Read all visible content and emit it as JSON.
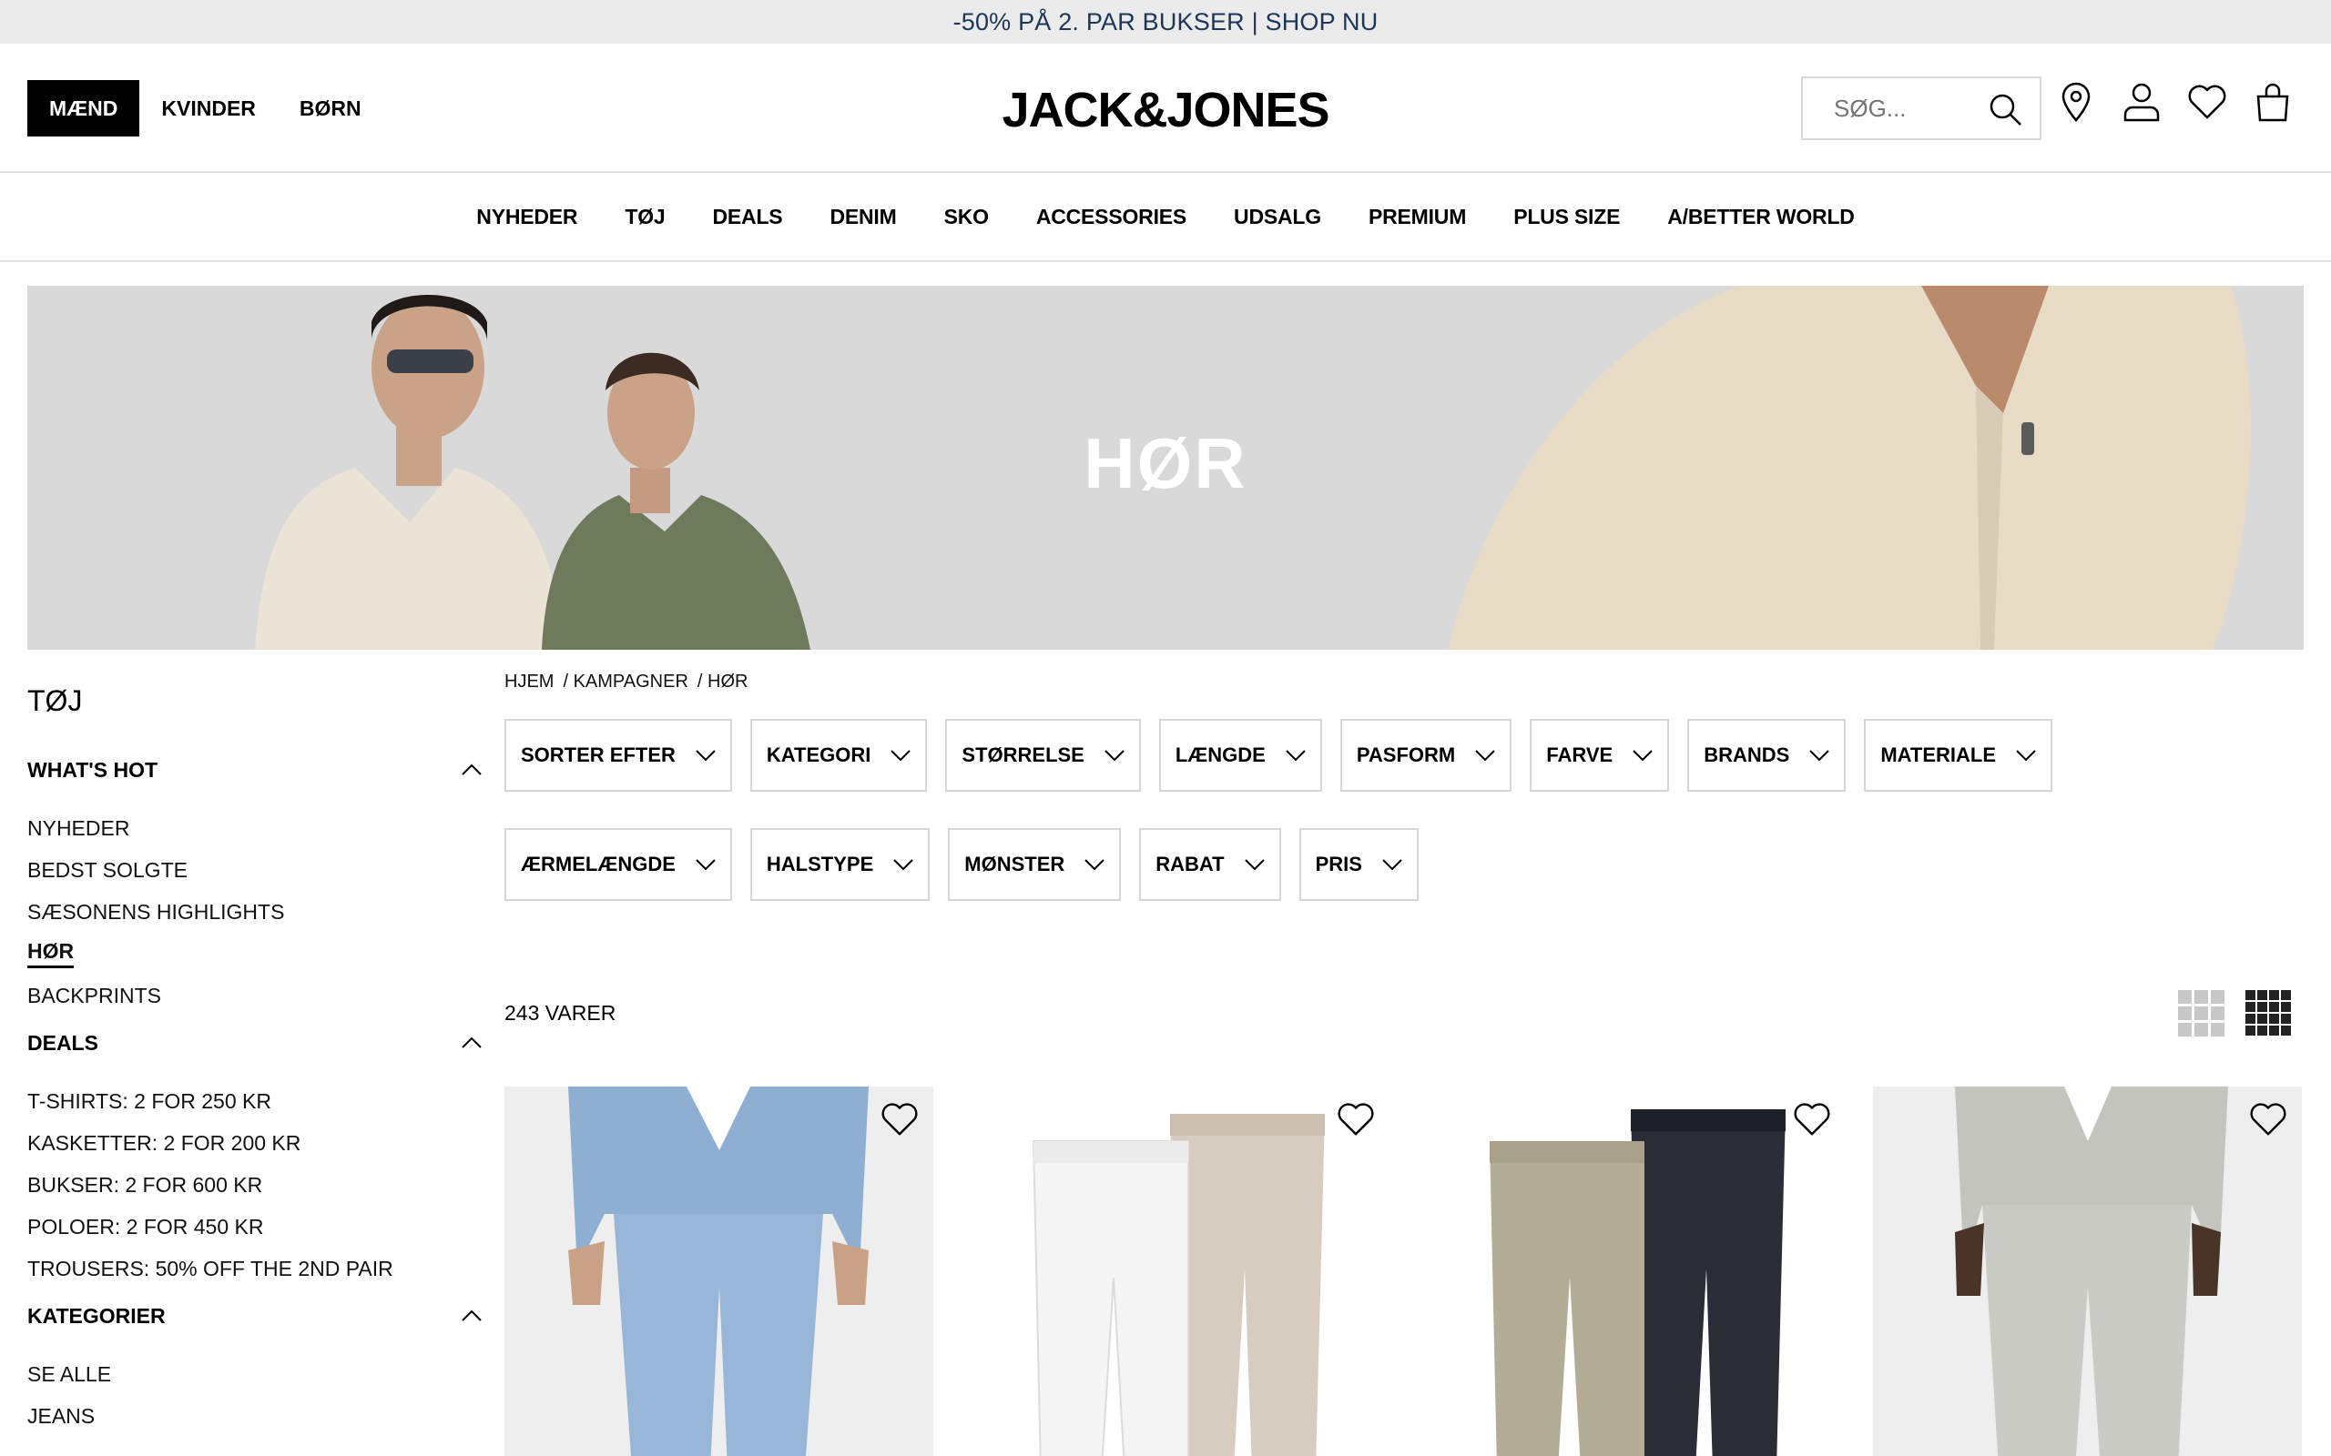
{
  "promo": {
    "text": "-50% PÅ 2. PAR BUKSER | SHOP NU"
  },
  "header": {
    "genders": [
      "MÆND",
      "KVINDER",
      "BØRN"
    ],
    "active_gender": "MÆND",
    "logo": "JACK&JONES",
    "search_placeholder": "SØG...",
    "icons": [
      "store-locator-icon",
      "account-icon",
      "wishlist-icon",
      "cart-icon"
    ]
  },
  "nav": [
    "NYHEDER",
    "TØJ",
    "DEALS",
    "DENIM",
    "SKO",
    "ACCESSORIES",
    "UDSALG",
    "PREMIUM",
    "PLUS SIZE",
    "A/BETTER WORLD"
  ],
  "hero": {
    "title": "HØR"
  },
  "sidebar": {
    "title": "TØJ",
    "sections": [
      {
        "heading": "WHAT'S HOT",
        "items": [
          "NYHEDER",
          "BEDST SOLGTE",
          "SÆSONENS HIGHLIGHTS",
          "HØR",
          "BACKPRINTS"
        ],
        "current": "HØR"
      },
      {
        "heading": "DEALS",
        "items": [
          "T-SHIRTS: 2 FOR 250 KR",
          "KASKETTER: 2 FOR 200 KR",
          "BUKSER: 2 FOR 600 KR",
          "POLOER: 2 FOR 450 KR",
          "TROUSERS: 50% OFF THE 2ND PAIR"
        ]
      },
      {
        "heading": "KATEGORIER",
        "items": [
          "SE ALLE",
          "JEANS"
        ]
      }
    ]
  },
  "breadcrumb": [
    "HJEM",
    "/ KAMPAGNER",
    "/ HØR"
  ],
  "filters": {
    "row1": [
      "SORTER EFTER",
      "KATEGORI",
      "STØRRELSE",
      "LÆNGDE",
      "PASFORM",
      "FARVE",
      "BRANDS",
      "MATERIALE"
    ],
    "row2": [
      "ÆRMELÆNGDE",
      "HALSTYPE",
      "MØNSTER",
      "RABAT",
      "PRIS"
    ]
  },
  "results": {
    "count_label": "243 VARER"
  },
  "colors": {
    "promo_bg": "#ebebeb",
    "promo_text": "#1d3557",
    "hero_bg": "#d8d8d8",
    "accent": "#000000"
  }
}
